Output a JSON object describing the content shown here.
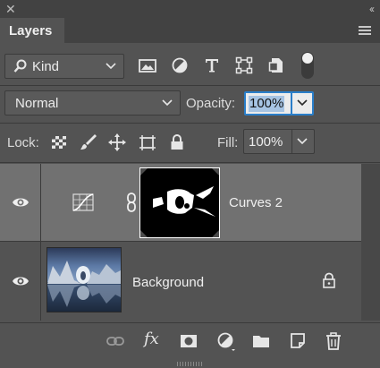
{
  "panel": {
    "title": "Layers",
    "close_glyph": "✕",
    "collapse_glyph": "‹‹"
  },
  "filter": {
    "kind_label": "Kind",
    "icons": [
      "pixel-filter-icon",
      "adjustment-filter-icon",
      "type-filter-icon",
      "shape-filter-icon",
      "smart-object-filter-icon"
    ]
  },
  "blend": {
    "mode": "Normal",
    "opacity_label": "Opacity:",
    "opacity_value": "100%"
  },
  "lock": {
    "label": "Lock:",
    "icons": [
      "lock-transparent-pixels-icon",
      "lock-image-pixels-icon",
      "lock-position-icon",
      "artboard-lock-icon",
      "lock-all-icon"
    ],
    "fill_label": "Fill:",
    "fill_value": "100%"
  },
  "layers": [
    {
      "name": "Curves 2",
      "visible": true,
      "selected": true,
      "type": "adjustment"
    },
    {
      "name": "Background",
      "visible": true,
      "selected": false,
      "locked": true,
      "type": "image"
    }
  ],
  "footer_icons": [
    "link-layers-icon",
    "fx-icon",
    "add-mask-icon",
    "new-fill-adjustment-icon",
    "new-group-icon",
    "new-layer-icon",
    "delete-layer-icon"
  ],
  "footer_fx_label": "fx",
  "colors": {
    "panel_bg": "#535353",
    "selected_row": "#717171",
    "accent_blue": "#2a7ec9"
  }
}
